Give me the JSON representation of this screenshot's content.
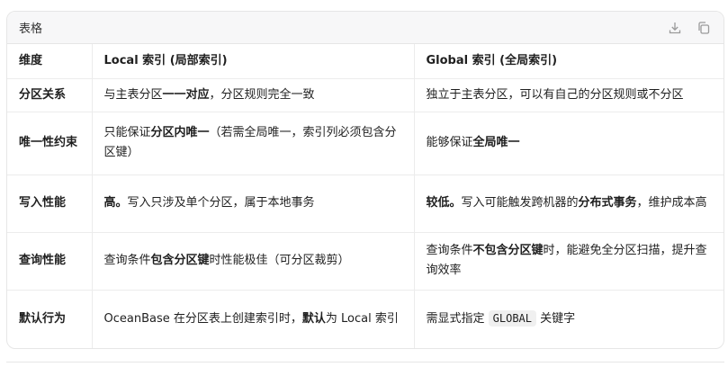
{
  "card": {
    "title": "表格",
    "icons": [
      "download-icon",
      "copy-icon"
    ]
  },
  "table": {
    "headers": [
      "维度",
      "Local 索引 (局部索引)",
      "Global 索引 (全局索引)"
    ],
    "rows": [
      {
        "dim": "分区关系",
        "local": {
          "a": "与主表分区",
          "b": "一一对应",
          "c": "，分区规则完全一致"
        },
        "global": {
          "a": "独立于主表分区，可以有自己的分区规则或不分区"
        }
      },
      {
        "dim": "唯一性约束",
        "local": {
          "a": "只能保证",
          "b": "分区内唯一",
          "c": "（若需全局唯一，索引列必须包含分区键）"
        },
        "global": {
          "a": "能够保证",
          "b": "全局唯一"
        }
      },
      {
        "dim": "写入性能",
        "local": {
          "b": "高。",
          "c": "写入只涉及单个分区，属于本地事务"
        },
        "global": {
          "b1": "较低。",
          "a": "写入可能触发跨机器的",
          "b2": "分布式事务",
          "c": "，维护成本高"
        }
      },
      {
        "dim": "查询性能",
        "local": {
          "a": "查询条件",
          "b": "包含分区键",
          "c": "时性能极佳（可分区裁剪）"
        },
        "global": {
          "a": "查询条件",
          "b": "不包含分区键",
          "c": "时，能避免全分区扫描，提升查询效率"
        }
      },
      {
        "dim": "默认行为",
        "local": {
          "a": "OceanBase 在分区表上创建索引时，",
          "b": "默认",
          "c": "为 Local 索引"
        },
        "global": {
          "a": "需显式指定 ",
          "code": "GLOBAL",
          "c": " 关键字"
        }
      }
    ]
  }
}
